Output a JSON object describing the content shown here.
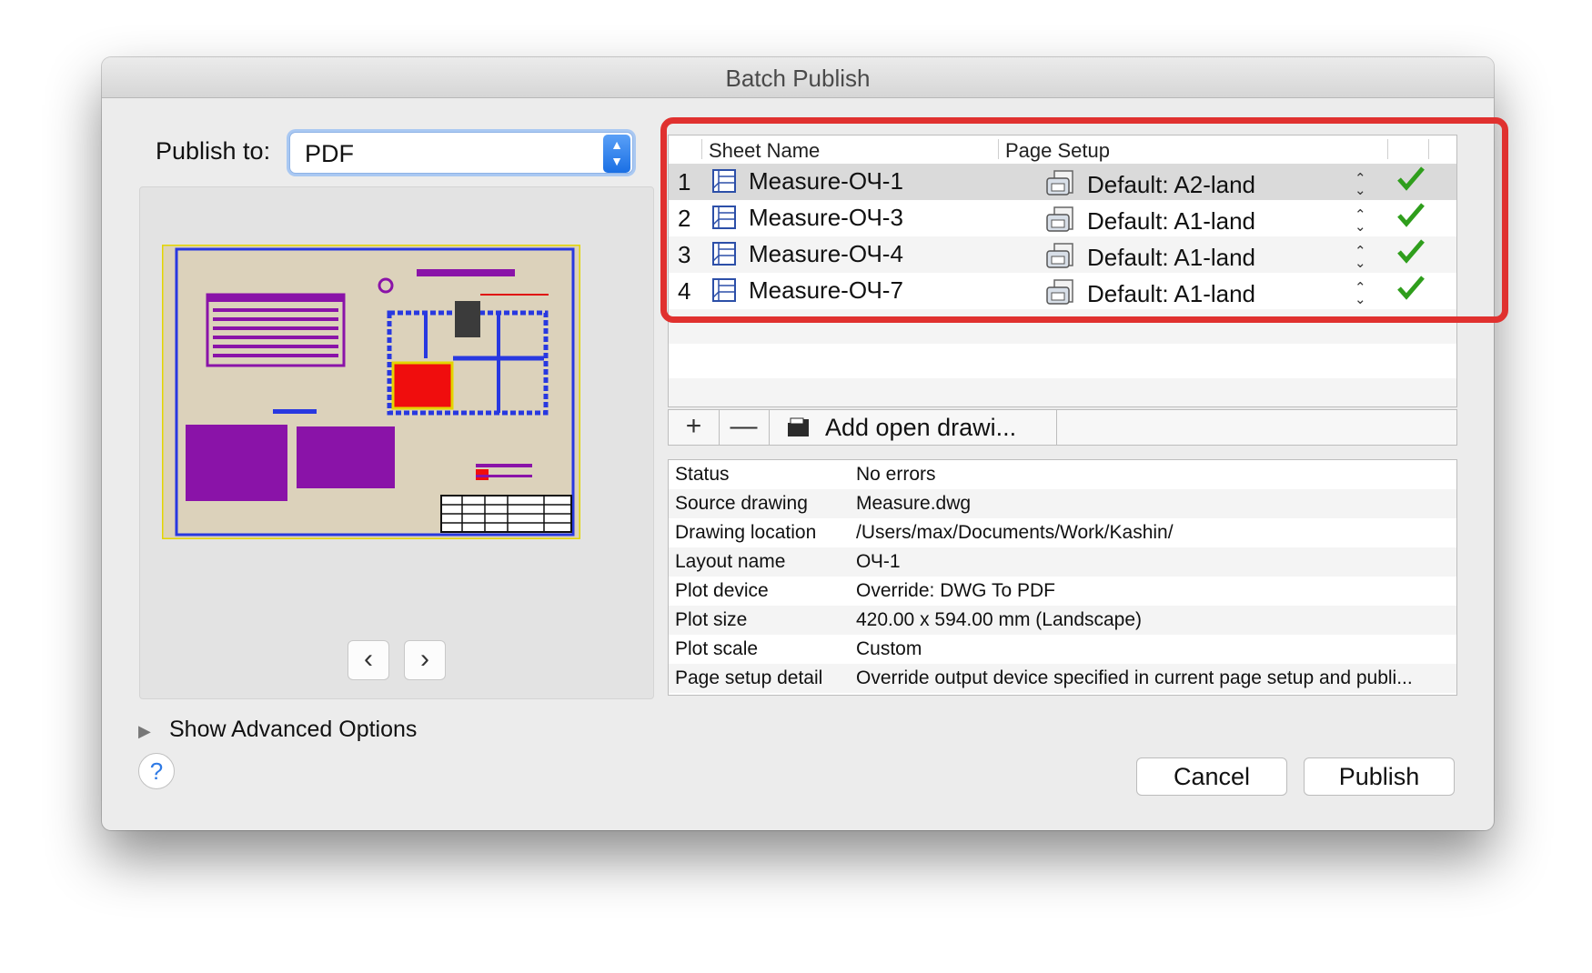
{
  "window": {
    "title": "Batch Publish"
  },
  "publish_to": {
    "label": "Publish to:",
    "value": "PDF"
  },
  "preview": {
    "prev_label": "‹",
    "next_label": "›"
  },
  "sheet_table": {
    "columns": {
      "sheet_name": "Sheet Name",
      "page_setup": "Page Setup"
    },
    "rows": [
      {
        "num": "1",
        "sheet": "Measure-ОЧ-1",
        "setup": "Default: A2-land",
        "ok": true
      },
      {
        "num": "2",
        "sheet": "Measure-ОЧ-3",
        "setup": "Default: A1-land",
        "ok": true
      },
      {
        "num": "3",
        "sheet": "Measure-ОЧ-4",
        "setup": "Default: A1-land",
        "ok": true
      },
      {
        "num": "4",
        "sheet": "Measure-ОЧ-7",
        "setup": "Default: A1-land",
        "ok": true
      }
    ]
  },
  "toolbar": {
    "add_label": "+",
    "remove_label": "—",
    "add_open_label": "Add open drawi..."
  },
  "properties": [
    {
      "key": "Status",
      "value": "No errors"
    },
    {
      "key": "Source drawing",
      "value": "Measure.dwg"
    },
    {
      "key": "Drawing location",
      "value": "/Users/max/Documents/Work/Kashin/"
    },
    {
      "key": "Layout name",
      "value": "ОЧ-1"
    },
    {
      "key": "Plot device",
      "value": "Override: DWG To PDF"
    },
    {
      "key": "Plot size",
      "value": "420.00 x 594.00 mm (Landscape)"
    },
    {
      "key": "Plot scale",
      "value": "Custom"
    },
    {
      "key": "Page setup detail",
      "value": "Override output device specified in current page setup and publi..."
    }
  ],
  "advanced": {
    "label": "Show Advanced Options"
  },
  "help": {
    "label": "?"
  },
  "buttons": {
    "cancel": "Cancel",
    "publish": "Publish"
  },
  "colors": {
    "highlight": "#e0312f",
    "check": "#2f9e1c",
    "accent": "#1a6fe4"
  }
}
